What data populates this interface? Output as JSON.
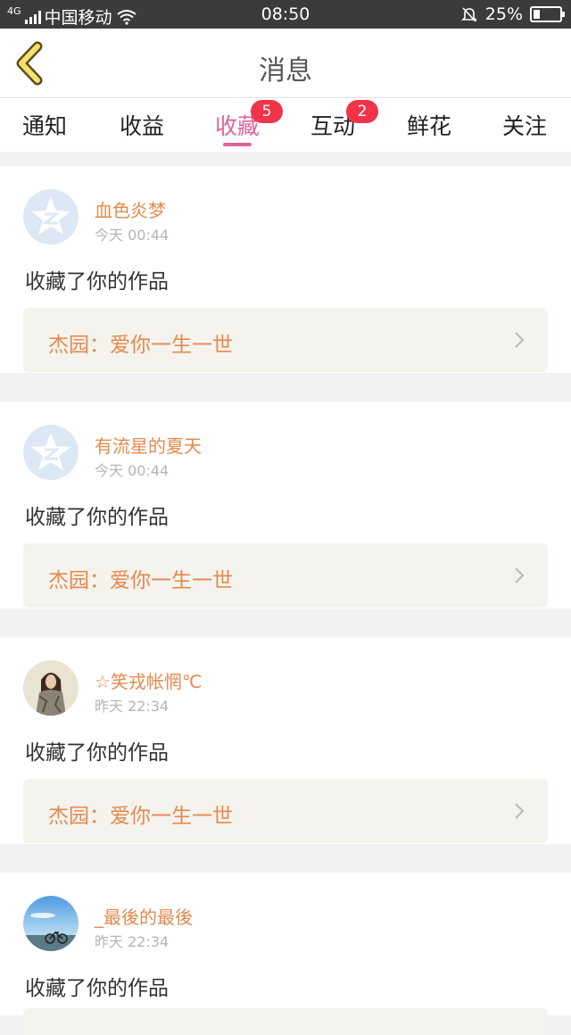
{
  "status_bar": {
    "network": "4G",
    "carrier": "中国移动",
    "time": "08:50",
    "battery": "25%",
    "battery_level": 0.25
  },
  "header": {
    "title": "消息"
  },
  "tabs": [
    {
      "label": "通知",
      "badge": ""
    },
    {
      "label": "收益",
      "badge": ""
    },
    {
      "label": "收藏",
      "badge": "5",
      "active": true
    },
    {
      "label": "互动",
      "badge": "2"
    },
    {
      "label": "鲜花",
      "badge": ""
    },
    {
      "label": "关注",
      "badge": ""
    }
  ],
  "messages": [
    {
      "user": "血色炎梦",
      "time": "今天 00:44",
      "action": "收藏了你的作品",
      "work": "杰园：爱你一生一世",
      "avatar": "qzone-default-avatar"
    },
    {
      "user": "有流星的夏天",
      "time": "今天 00:44",
      "action": "收藏了你的作品",
      "work": "杰园：爱你一生一世",
      "avatar": "qzone-default-avatar"
    },
    {
      "user": "☆笑戎帐惘℃",
      "time": "昨天 22:34",
      "action": "收藏了你的作品",
      "work": "杰园：爱你一生一世",
      "avatar": "girl-photo-avatar"
    },
    {
      "user": "_最後的最後",
      "time": "昨天 22:34",
      "action": "收藏了你的作品",
      "work": "",
      "avatar": "sky-bicycle-avatar"
    }
  ],
  "colors": {
    "accent_pink": "#e0649a",
    "username_orange": "#e58a4e",
    "badge_red": "#f1344a",
    "back_yellow": "#f5e06a"
  }
}
